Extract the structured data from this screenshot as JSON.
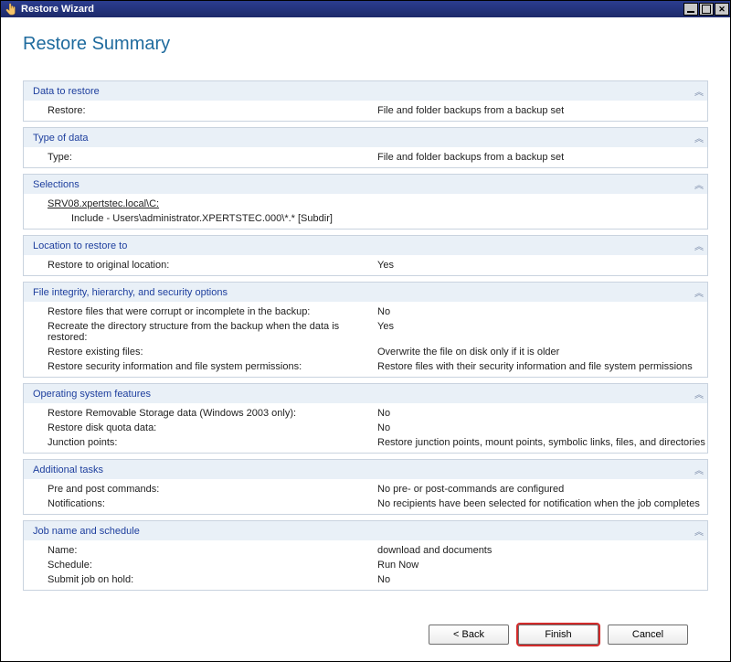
{
  "window": {
    "title": "Restore Wizard",
    "icon": "hand-pointer-icon"
  },
  "page": {
    "heading": "Restore Summary"
  },
  "sections": {
    "data_to_restore": {
      "title": "Data to restore",
      "restore_label": "Restore:",
      "restore_value": "File and folder backups from a backup set"
    },
    "type_of_data": {
      "title": "Type of data",
      "type_label": "Type:",
      "type_value": "File and folder backups from a backup set"
    },
    "selections": {
      "title": "Selections",
      "host": "SRV08.xpertstec.local\\C:",
      "include": "Include - Users\\administrator.XPERTSTEC.000\\*.* [Subdir]"
    },
    "location": {
      "title": "Location to restore to",
      "orig_label": "Restore to original location:",
      "orig_value": "Yes"
    },
    "integrity": {
      "title": "File integrity, hierarchy, and security options",
      "corrupt_label": "Restore files that were corrupt or incomplete in the backup:",
      "corrupt_value": "No",
      "recreate_label": "Recreate the directory structure from the backup when the data is restored:",
      "recreate_value": "Yes",
      "existing_label": "Restore existing files:",
      "existing_value": "Overwrite the file on disk only if it is older",
      "security_label": "Restore security information and file system permissions:",
      "security_value": "Restore files with their security information and file system permissions"
    },
    "os": {
      "title": "Operating system features",
      "removable_label": "Restore Removable Storage data (Windows 2003 only):",
      "removable_value": "No",
      "quota_label": "Restore disk quota data:",
      "quota_value": "No",
      "junction_label": "Junction points:",
      "junction_value": "Restore junction points, mount points, symbolic links, files, and directories"
    },
    "tasks": {
      "title": "Additional tasks",
      "prepost_label": "Pre and post commands:",
      "prepost_value": "No pre- or post-commands are configured",
      "notify_label": "Notifications:",
      "notify_value": "No recipients have been selected for notification when the job completes"
    },
    "job": {
      "title": "Job name and schedule",
      "name_label": "Name:",
      "name_value": "download and documents",
      "schedule_label": "Schedule:",
      "schedule_value": "Run Now",
      "hold_label": "Submit job on hold:",
      "hold_value": "No"
    }
  },
  "buttons": {
    "back": "< Back",
    "finish": "Finish",
    "cancel": "Cancel"
  },
  "icons": {
    "collapse": "︽"
  }
}
